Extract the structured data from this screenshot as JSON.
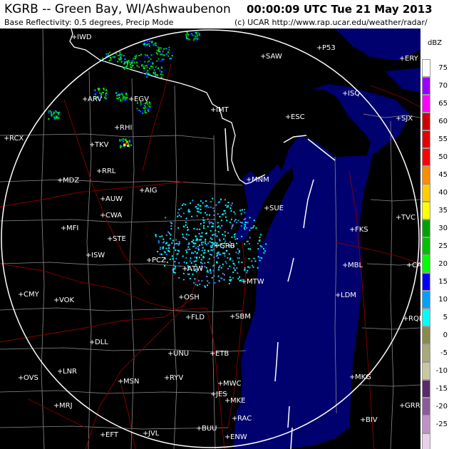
{
  "header": {
    "station": "KGRB -- Green Bay, WI/Ashwaubenon",
    "timestamp": "00:00:09 UTC Tue 21 May 2013",
    "product": "Base Reflectivity: 0.5 degrees, Precip Mode",
    "credit": "(c) UCAR  http://www.rap.ucar.edu/weather/radar/"
  },
  "legend": {
    "unit": "dBZ",
    "entries": [
      {
        "label": "75",
        "color": "#ffffff"
      },
      {
        "label": "70",
        "color": "#9b00ff"
      },
      {
        "label": "65",
        "color": "#ff00ff"
      },
      {
        "label": "60",
        "color": "#cc0000"
      },
      {
        "label": "55",
        "color": "#e00000"
      },
      {
        "label": "50",
        "color": "#ff0000"
      },
      {
        "label": "45",
        "color": "#ff8c00"
      },
      {
        "label": "40",
        "color": "#ffcc00"
      },
      {
        "label": "35",
        "color": "#ffff00"
      },
      {
        "label": "30",
        "color": "#00a000"
      },
      {
        "label": "25",
        "color": "#00c000"
      },
      {
        "label": "20",
        "color": "#00ff00"
      },
      {
        "label": "15",
        "color": "#0000ff"
      },
      {
        "label": "10",
        "color": "#00a0ff"
      },
      {
        "label": "5",
        "color": "#00ffff"
      },
      {
        "label": "0",
        "color": "#8a8a4a"
      },
      {
        "label": "-5",
        "color": "#a8a878"
      },
      {
        "label": "-10",
        "color": "#c8c8a0"
      },
      {
        "label": "-15",
        "color": "#5a2a6a"
      },
      {
        "label": "-20",
        "color": "#8a5a9a"
      },
      {
        "label": "-25",
        "color": "#c090c8"
      },
      {
        "label": "",
        "color": "#e8d0ea"
      },
      {
        "label": "",
        "color": "#d8ffff"
      }
    ]
  },
  "map": {
    "water_color": "#00006e",
    "range_ring_color": "#ffffff",
    "county_color": "#8a8a8a",
    "highway_color": "#8a0000",
    "cities": [
      {
        "code": "IWD"
      },
      {
        "code": "SAW"
      },
      {
        "code": "P53"
      },
      {
        "code": "ERY"
      },
      {
        "code": "ARV"
      },
      {
        "code": "EGV"
      },
      {
        "code": "ISQ"
      },
      {
        "code": "RHI"
      },
      {
        "code": "IMT"
      },
      {
        "code": "ESC"
      },
      {
        "code": "SJX"
      },
      {
        "code": "RCX"
      },
      {
        "code": "TKV"
      },
      {
        "code": "RRL"
      },
      {
        "code": "MNM"
      },
      {
        "code": "MDZ"
      },
      {
        "code": "AIG"
      },
      {
        "code": "AUW"
      },
      {
        "code": "SUE"
      },
      {
        "code": "TVC"
      },
      {
        "code": "CWA"
      },
      {
        "code": "MFI"
      },
      {
        "code": "STE"
      },
      {
        "code": "FKS"
      },
      {
        "code": "ISW"
      },
      {
        "code": "PCZ"
      },
      {
        "code": "GRB"
      },
      {
        "code": "ATW"
      },
      {
        "code": "MTW"
      },
      {
        "code": "MBL"
      },
      {
        "code": "CAD"
      },
      {
        "code": "CMY"
      },
      {
        "code": "VOK"
      },
      {
        "code": "OSH"
      },
      {
        "code": "LDM"
      },
      {
        "code": "FLD"
      },
      {
        "code": "SBM"
      },
      {
        "code": "RQB"
      },
      {
        "code": "DLL"
      },
      {
        "code": "UNU"
      },
      {
        "code": "ETB"
      },
      {
        "code": "LNR"
      },
      {
        "code": "MKG"
      },
      {
        "code": "OVS"
      },
      {
        "code": "MSN"
      },
      {
        "code": "RYV"
      },
      {
        "code": "MWC"
      },
      {
        "code": "JES"
      },
      {
        "code": "MKE"
      },
      {
        "code": "GRR"
      },
      {
        "code": "MRJ"
      },
      {
        "code": "RAC"
      },
      {
        "code": "BIV"
      },
      {
        "code": "EFT"
      },
      {
        "code": "JVL"
      },
      {
        "code": "BUU"
      },
      {
        "code": "ENW"
      }
    ]
  }
}
